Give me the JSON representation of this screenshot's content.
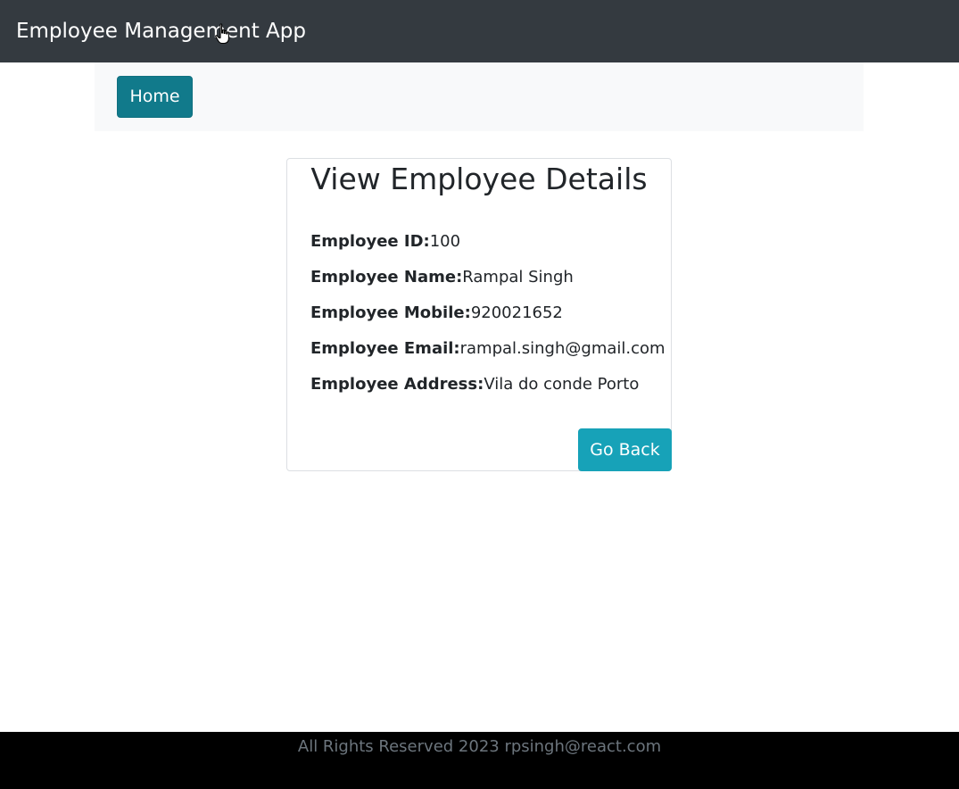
{
  "header": {
    "title": "Employee Management App"
  },
  "nav": {
    "home_label": "Home"
  },
  "card": {
    "title": "View Employee Details",
    "details": [
      {
        "label": "Employee ID:",
        "value": "100"
      },
      {
        "label": "Employee Name:",
        "value": "Rampal Singh"
      },
      {
        "label": "Employee Mobile:",
        "value": "920021652"
      },
      {
        "label": "Employee Email:",
        "value": "rampal.singh@gmail.com"
      },
      {
        "label": "Employee Address:",
        "value": "Vila do conde Porto"
      }
    ],
    "go_back_label": "Go Back"
  },
  "footer": {
    "text": "All Rights Reserved 2023 rpsingh@react.com"
  },
  "colors": {
    "header_bg": "#343a40",
    "home_button": "#117a8b",
    "go_back_button": "#17a2b8",
    "footer_bg": "#000000",
    "footer_text": "#6c757d"
  },
  "icons": {
    "cursor": "hand-pointer-cursor-icon"
  }
}
